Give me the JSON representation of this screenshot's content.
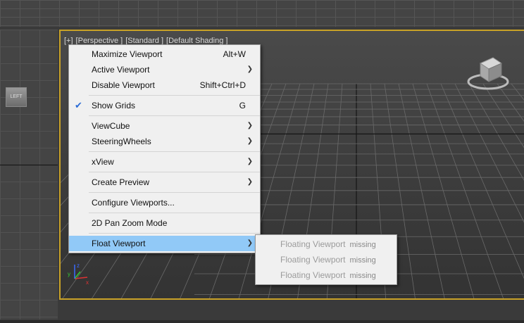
{
  "viewport": {
    "label_parts": [
      "[+]",
      "[Perspective ]",
      "[Standard ]",
      "[Default Shading ]"
    ],
    "left_viewcube_face": "LEFT",
    "gizmo_axes": [
      "x",
      "y",
      "z"
    ]
  },
  "context_menu": {
    "items": [
      {
        "label": "Maximize Viewport",
        "shortcut": "Alt+W"
      },
      {
        "label": "Active Viewport",
        "submenu": true
      },
      {
        "label": "Disable Viewport",
        "shortcut": "Shift+Ctrl+D"
      },
      {
        "label": "Show Grids",
        "shortcut": "G",
        "checked": true
      },
      {
        "label": "ViewCube",
        "submenu": true
      },
      {
        "label": "SteeringWheels",
        "submenu": true
      },
      {
        "label": "xView",
        "submenu": true
      },
      {
        "label": "Create Preview",
        "submenu": true
      },
      {
        "label": "Configure Viewports..."
      },
      {
        "label": "2D Pan Zoom Mode"
      },
      {
        "label": "Float Viewport",
        "submenu": true,
        "highlighted": true
      }
    ]
  },
  "float_submenu": {
    "items": [
      {
        "label": "Floating Viewport",
        "status": "missing"
      },
      {
        "label": "Floating Viewport",
        "status": "missing"
      },
      {
        "label": "Floating Viewport",
        "status": "missing"
      }
    ]
  },
  "colors": {
    "active_border": "#c9a227",
    "menu_highlight": "#91c9f7",
    "check": "#2a6bd6"
  }
}
